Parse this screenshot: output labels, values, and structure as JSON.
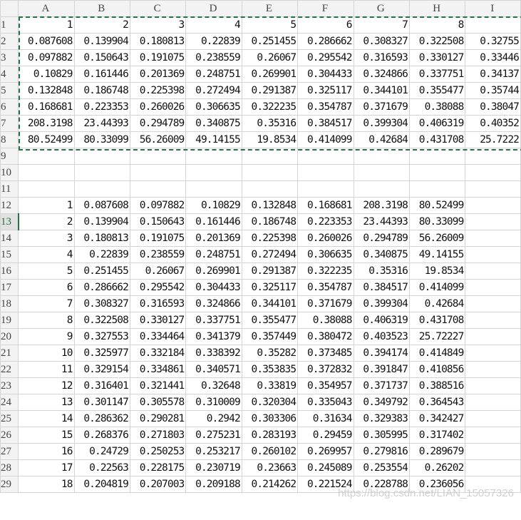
{
  "columns": [
    "A",
    "B",
    "C",
    "D",
    "E",
    "F",
    "G",
    "H",
    "I"
  ],
  "watermark": "https://blog.csdn.net/LIAN_15057326",
  "rows": [
    {
      "num": "1",
      "cells": [
        "1",
        "2",
        "3",
        "4",
        "5",
        "6",
        "7",
        "8",
        ""
      ]
    },
    {
      "num": "2",
      "cells": [
        "0.087608",
        "0.139904",
        "0.180813",
        "0.22839",
        "0.251455",
        "0.286662",
        "0.308327",
        "0.322508",
        "0.32755"
      ]
    },
    {
      "num": "3",
      "cells": [
        "0.097882",
        "0.150643",
        "0.191075",
        "0.238559",
        "0.26067",
        "0.295542",
        "0.316593",
        "0.330127",
        "0.33446"
      ]
    },
    {
      "num": "4",
      "cells": [
        "0.10829",
        "0.161446",
        "0.201369",
        "0.248751",
        "0.269901",
        "0.304433",
        "0.324866",
        "0.337751",
        "0.34137"
      ]
    },
    {
      "num": "5",
      "cells": [
        "0.132848",
        "0.186748",
        "0.225398",
        "0.272494",
        "0.291387",
        "0.325117",
        "0.344101",
        "0.355477",
        "0.35744"
      ]
    },
    {
      "num": "6",
      "cells": [
        "0.168681",
        "0.223353",
        "0.260026",
        "0.306635",
        "0.322235",
        "0.354787",
        "0.371679",
        "0.38088",
        "0.38047"
      ]
    },
    {
      "num": "7",
      "cells": [
        "208.3198",
        "23.44393",
        "0.294789",
        "0.340875",
        "0.35316",
        "0.384517",
        "0.399304",
        "0.406319",
        "0.40352"
      ]
    },
    {
      "num": "8",
      "cells": [
        "80.52499",
        "80.33099",
        "56.26009",
        "49.14155",
        "19.8534",
        "0.414099",
        "0.42684",
        "0.431708",
        "25.7222"
      ]
    },
    {
      "num": "9",
      "cells": [
        "",
        "",
        "",
        "",
        "",
        "",
        "",
        "",
        ""
      ]
    },
    {
      "num": "10",
      "cells": [
        "",
        "",
        "",
        "",
        "",
        "",
        "",
        "",
        ""
      ]
    },
    {
      "num": "11",
      "cells": [
        "",
        "",
        "",
        "",
        "",
        "",
        "",
        "",
        ""
      ]
    },
    {
      "num": "12",
      "cells": [
        "1",
        "0.087608",
        "0.097882",
        "0.10829",
        "0.132848",
        "0.168681",
        "208.3198",
        "80.52499",
        ""
      ]
    },
    {
      "num": "13",
      "cells": [
        "2",
        "0.139904",
        "0.150643",
        "0.161446",
        "0.186748",
        "0.223353",
        "23.44393",
        "80.33099",
        ""
      ]
    },
    {
      "num": "14",
      "cells": [
        "3",
        "0.180813",
        "0.191075",
        "0.201369",
        "0.225398",
        "0.260026",
        "0.294789",
        "56.26009",
        ""
      ]
    },
    {
      "num": "15",
      "cells": [
        "4",
        "0.22839",
        "0.238559",
        "0.248751",
        "0.272494",
        "0.306635",
        "0.340875",
        "49.14155",
        ""
      ]
    },
    {
      "num": "16",
      "cells": [
        "5",
        "0.251455",
        "0.26067",
        "0.269901",
        "0.291387",
        "0.322235",
        "0.35316",
        "19.8534",
        ""
      ]
    },
    {
      "num": "17",
      "cells": [
        "6",
        "0.286662",
        "0.295542",
        "0.304433",
        "0.325117",
        "0.354787",
        "0.384517",
        "0.414099",
        ""
      ]
    },
    {
      "num": "18",
      "cells": [
        "7",
        "0.308327",
        "0.316593",
        "0.324866",
        "0.344101",
        "0.371679",
        "0.399304",
        "0.42684",
        ""
      ]
    },
    {
      "num": "19",
      "cells": [
        "8",
        "0.322508",
        "0.330127",
        "0.337751",
        "0.355477",
        "0.38088",
        "0.406319",
        "0.431708",
        ""
      ]
    },
    {
      "num": "20",
      "cells": [
        "9",
        "0.327553",
        "0.334464",
        "0.341379",
        "0.357449",
        "0.380472",
        "0.403523",
        "25.72227",
        ""
      ]
    },
    {
      "num": "21",
      "cells": [
        "10",
        "0.325977",
        "0.332184",
        "0.338392",
        "0.35282",
        "0.373485",
        "0.394174",
        "0.414849",
        ""
      ]
    },
    {
      "num": "22",
      "cells": [
        "11",
        "0.329154",
        "0.334861",
        "0.340571",
        "0.353835",
        "0.372832",
        "0.391847",
        "0.410856",
        ""
      ]
    },
    {
      "num": "23",
      "cells": [
        "12",
        "0.316401",
        "0.321441",
        "0.32648",
        "0.33819",
        "0.354957",
        "0.371737",
        "0.388516",
        ""
      ]
    },
    {
      "num": "24",
      "cells": [
        "13",
        "0.301147",
        "0.305578",
        "0.310009",
        "0.320304",
        "0.335043",
        "0.349792",
        "0.364543",
        ""
      ]
    },
    {
      "num": "25",
      "cells": [
        "14",
        "0.286362",
        "0.290281",
        "0.2942",
        "0.303306",
        "0.31634",
        "0.329383",
        "0.342427",
        ""
      ]
    },
    {
      "num": "26",
      "cells": [
        "15",
        "0.268376",
        "0.271803",
        "0.275231",
        "0.283193",
        "0.29459",
        "0.305995",
        "0.317402",
        ""
      ]
    },
    {
      "num": "27",
      "cells": [
        "16",
        "0.24729",
        "0.250253",
        "0.253217",
        "0.260102",
        "0.269957",
        "0.279816",
        "0.289679",
        ""
      ]
    },
    {
      "num": "28",
      "cells": [
        "17",
        "0.22563",
        "0.228175",
        "0.230719",
        "0.23663",
        "0.245089",
        "0.253554",
        "0.26202",
        ""
      ]
    },
    {
      "num": "29",
      "cells": [
        "18",
        "0.204819",
        "0.207003",
        "0.209188",
        "0.214262",
        "0.221524",
        "0.228788",
        "0.236056",
        ""
      ]
    }
  ]
}
